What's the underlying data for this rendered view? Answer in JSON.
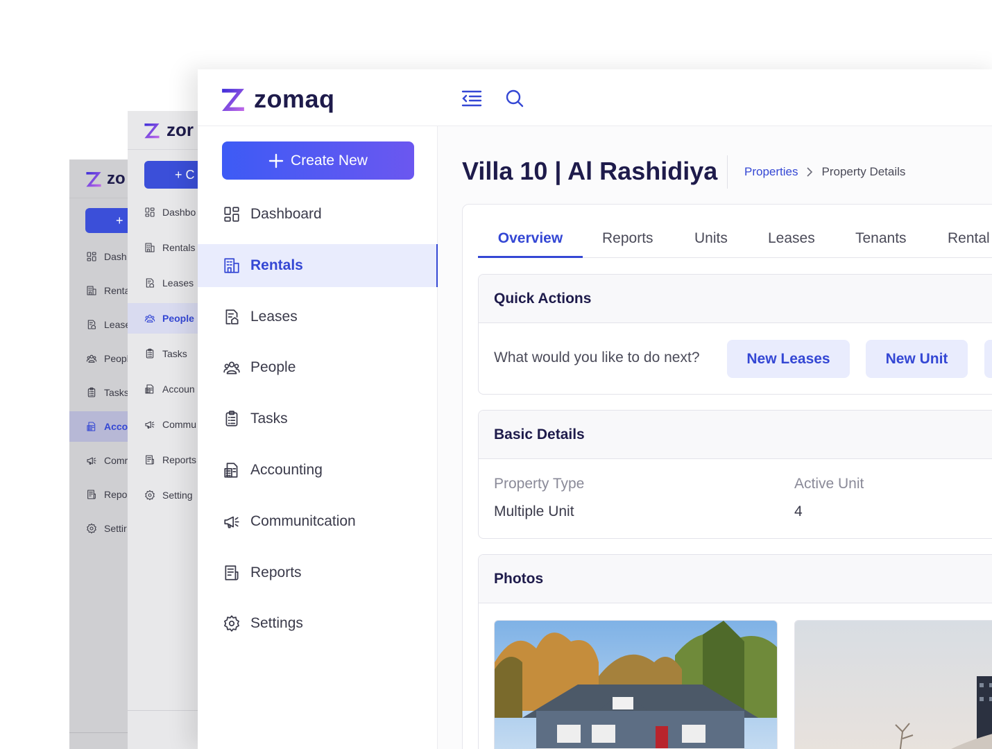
{
  "app": {
    "name": "zomaq"
  },
  "back_layer": {
    "logo_text": "zo"
  },
  "mid_layer": {
    "logo_text": "zor"
  },
  "layer_nav": {
    "back": [
      {
        "label": "Dash",
        "icon": "dashboard-icon"
      },
      {
        "label": "Renta",
        "icon": "rentals-icon"
      },
      {
        "label": "Lease",
        "icon": "leases-icon"
      },
      {
        "label": "Peopl",
        "icon": "people-icon"
      },
      {
        "label": "Tasks",
        "icon": "tasks-icon"
      },
      {
        "label": "Acco",
        "icon": "accounting-icon",
        "active": true
      },
      {
        "label": "Comr",
        "icon": "communication-icon"
      },
      {
        "label": "Repo",
        "icon": "reports-icon"
      },
      {
        "label": "Settir",
        "icon": "settings-icon"
      }
    ],
    "mid": [
      {
        "label": "Dashbo",
        "icon": "dashboard-icon"
      },
      {
        "label": "Rentals",
        "icon": "rentals-icon"
      },
      {
        "label": "Leases",
        "icon": "leases-icon"
      },
      {
        "label": "People",
        "icon": "people-icon",
        "active": true
      },
      {
        "label": "Tasks",
        "icon": "tasks-icon"
      },
      {
        "label": "Accoun",
        "icon": "accounting-icon"
      },
      {
        "label": "Commu",
        "icon": "communication-icon"
      },
      {
        "label": "Reports",
        "icon": "reports-icon"
      },
      {
        "label": "Setting",
        "icon": "settings-icon"
      }
    ],
    "back_btn": "+",
    "mid_btn": "+ C"
  },
  "topbar": {
    "menu_icon": "menu-collapse-icon",
    "search_icon": "search-icon"
  },
  "sidebar": {
    "create_label": "Create New",
    "items": [
      {
        "label": "Dashboard",
        "icon": "dashboard-icon"
      },
      {
        "label": "Rentals",
        "icon": "rentals-icon",
        "active": true
      },
      {
        "label": "Leases",
        "icon": "leases-icon"
      },
      {
        "label": "People",
        "icon": "people-icon"
      },
      {
        "label": "Tasks",
        "icon": "tasks-icon"
      },
      {
        "label": "Accounting",
        "icon": "accounting-icon"
      },
      {
        "label": "Communitcation",
        "icon": "communication-icon"
      },
      {
        "label": "Reports",
        "icon": "reports-icon"
      },
      {
        "label": "Settings",
        "icon": "settings-icon"
      }
    ]
  },
  "page": {
    "title": "Villa 10 | Al Rashidiya",
    "breadcrumb": {
      "parent": "Properties",
      "current": "Property Details"
    }
  },
  "tabs": [
    "Overview",
    "Reports",
    "Units",
    "Leases",
    "Tenants",
    "Rental"
  ],
  "active_tab": "Overview",
  "quick_actions": {
    "title": "Quick Actions",
    "prompt": "What would you like to do next?",
    "buttons": [
      "New Leases",
      "New Unit"
    ]
  },
  "basic_details": {
    "title": "Basic Details",
    "fields": [
      {
        "label": "Property Type",
        "value": "Multiple Unit"
      },
      {
        "label": "Active Unit",
        "value": "4"
      }
    ]
  },
  "photos": {
    "title": "Photos"
  },
  "colors": {
    "accent": "#3447d4",
    "brand_dark": "#1e1b4b",
    "active_bg": "#e9ecfd"
  }
}
